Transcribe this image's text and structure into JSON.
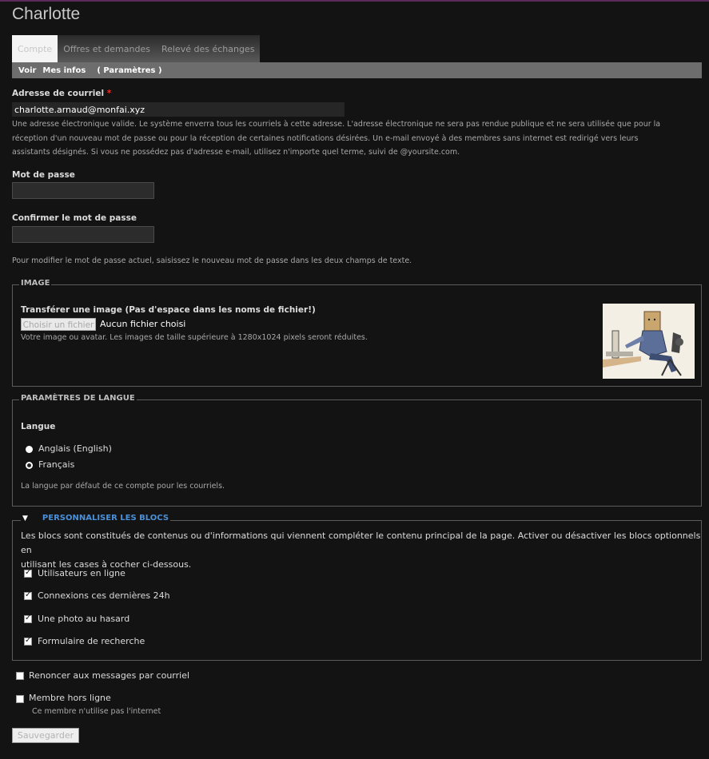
{
  "page": {
    "title": "Charlotte"
  },
  "tabs": [
    {
      "label": "Compte",
      "active": true
    },
    {
      "label": "Offres et demandes",
      "active": false
    },
    {
      "label": "Relevé des échanges",
      "active": false
    }
  ],
  "subtabs": [
    {
      "label": "Voir"
    },
    {
      "label": "Mes infos"
    },
    {
      "label": "( Paramètres )",
      "active": true
    }
  ],
  "email": {
    "label": "Adresse de courriel",
    "required_mark": "*",
    "value": "charlotte.arnaud@monfai.xyz",
    "description_lines": [
      "Une adresse électronique valide. Le système enverra tous les courriels à cette adresse. L'adresse électronique ne sera pas rendue publique et ne sera utilisée que pour la",
      "réception d'un nouveau mot de passe ou pour la réception de certaines notifications désirées. Un e-mail envoyé à des membres sans internet est redirigé vers leurs",
      "assistants désignés. Si vous ne possédez pas d'adresse e-mail, utilisez n'importe quel terme, suivi de @yoursite.com."
    ]
  },
  "password": {
    "label": "Mot de passe",
    "confirm_label": "Confirmer le mot de passe",
    "description": "Pour modifier le mot de passe actuel, saisissez le nouveau mot de passe dans les deux champs de texte."
  },
  "image_section": {
    "legend": "IMAGE",
    "upload_label": "Transférer une image (Pas d'espace dans les noms de fichier!)",
    "button_label": "Choisir un fichier",
    "no_file_text": "Aucun fichier choisi",
    "description": "Votre image ou avatar. Les images de taille supérieure à 1280x1024 pixels seront réduites."
  },
  "language_section": {
    "legend": "PARAMÈTRES DE LANGUE",
    "field_label": "Langue",
    "options": [
      {
        "label": "Anglais (English)",
        "selected": false
      },
      {
        "label": "Français",
        "selected": true
      }
    ],
    "description": "La langue par défaut de ce compte pour les courriels."
  },
  "blocks_section": {
    "legend": "PERSONNALISER LES BLOCS",
    "legend_color": "#4a90d9",
    "description_lines": [
      "Les blocs sont constitués de contenus ou d'informations qui viennent compléter le contenu principal de la page. Activer ou désactiver les blocs optionnels en",
      "utilisant les cases à cocher ci-dessous."
    ],
    "items": [
      {
        "label": "Utilisateurs en ligne",
        "checked": true
      },
      {
        "label": "Connexions ces dernières 24h",
        "checked": true
      },
      {
        "label": "Une photo au hasard",
        "checked": true
      },
      {
        "label": "Formulaire de recherche",
        "checked": true
      }
    ]
  },
  "options": {
    "renounce_label": "Renoncer aux messages par courriel",
    "offline_label": "Membre hors ligne",
    "offline_description": "Ce membre n'utilise pas l'internet"
  },
  "save_label": "Sauvegarder"
}
